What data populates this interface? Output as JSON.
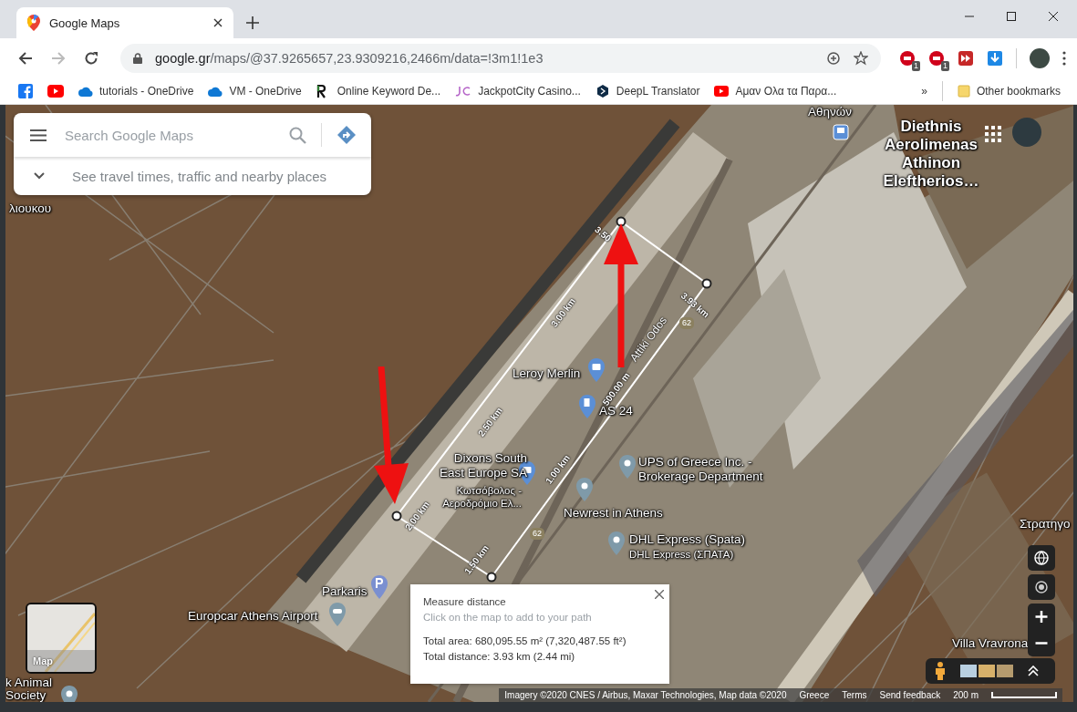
{
  "tab": {
    "title": "Google Maps"
  },
  "address": {
    "host": "google.gr",
    "path": "/maps/@37.9265657,23.9309216,2466m/data=!3m1!1e3"
  },
  "extension_badges": [
    "1",
    "1"
  ],
  "bookmarks": [
    "tutorials - OneDrive",
    "VM - OneDrive",
    "Online Keyword De...",
    "JackpotCity Casino...",
    "DeepL Translator",
    "Αμαν Ολα τα Παρα..."
  ],
  "bookmarks_overflow": "»",
  "other_bookmarks": "Other bookmarks",
  "search": {
    "placeholder": "Search Google Maps",
    "hint": "See travel times, traffic and nearby places"
  },
  "map": {
    "labels": [
      {
        "text": "Αθηνών",
        "kind": "station"
      },
      {
        "text": "Diethnis Aerolimenas Athinon Eleftherios…",
        "kind": "area"
      },
      {
        "text": "λιουκου",
        "kind": "area"
      },
      {
        "text": "Leroy Merlin",
        "kind": "shop"
      },
      {
        "text": "AS 24",
        "kind": "fuel"
      },
      {
        "text": "Dixons South East Europe SA",
        "kind": "shop"
      },
      {
        "text": "Κωτσόβολος - Αεροδρόμιο Ελ...",
        "kind": "sub"
      },
      {
        "text": "UPS of Greece Inc. - Brokerage Department",
        "kind": "pin"
      },
      {
        "text": "Newrest in Athens",
        "kind": "pin"
      },
      {
        "text": "DHL Express (Spata)",
        "kind": "pin"
      },
      {
        "text": "DHL Express (ΣΠΑΤΑ)",
        "kind": "sub"
      },
      {
        "text": "Parkaris",
        "kind": "parking"
      },
      {
        "text": "Europcar Athens Airport",
        "kind": "car"
      },
      {
        "text": "Στρατηγο",
        "kind": "area"
      },
      {
        "text": "Villa Vravrona",
        "kind": "area"
      },
      {
        "text": "k Animal Society",
        "kind": "pin"
      }
    ],
    "road_name": "Attiki Odos",
    "road_shields": [
      "62",
      "62"
    ],
    "measure_labels": [
      "3.50",
      "3.93 km",
      "3.00 km",
      "2.50 km",
      "2.00 km",
      "1.50 km",
      "1.00 km",
      "500.00 m"
    ]
  },
  "measure_panel": {
    "title": "Measure distance",
    "hint": "Click on the map to add to your path",
    "area": "Total area: 680,095.55 m² (7,320,487.55 ft²)",
    "distance": "Total distance: 3.93 km (2.44 mi)"
  },
  "layer_toggle": {
    "label": "Map"
  },
  "attribution": {
    "imagery": "Imagery ©2020 CNES / Airbus, Maxar Technologies, Map data ©2020",
    "region": "Greece",
    "terms": "Terms",
    "feedback": "Send feedback",
    "scale": "200 m"
  }
}
